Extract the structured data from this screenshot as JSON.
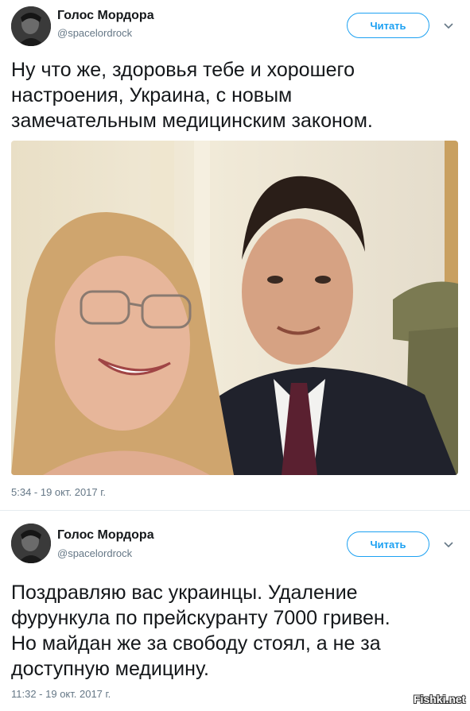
{
  "tweets": [
    {
      "author_name": "Голос Мордора",
      "author_handle": "@spacelordrock",
      "follow_label": "Читать",
      "text": "Ну что же, здоровья тебе и хорошего\nнастроения, Украина, с новым\nзамечательным медицинским законом.",
      "timestamp": "5:34 - 19 окт. 2017 г."
    },
    {
      "author_name": "Голос Мордора",
      "author_handle": "@spacelordrock",
      "follow_label": "Читать",
      "text": "Поздравляю вас украинцы. Удаление\nфурункула по прейскуранту 7000 гривен.\nНо майдан же за свободу стоял, а не за\nдоступную медицину.",
      "timestamp": "11:32 - 19 окт. 2017 г."
    }
  ],
  "watermark": "Fishki.net",
  "colors": {
    "accent": "#1da1f2",
    "text": "#14171a",
    "secondary": "#657786"
  }
}
